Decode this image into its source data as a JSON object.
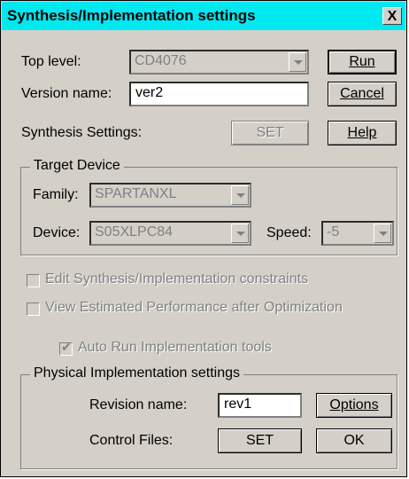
{
  "window": {
    "title": "Synthesis/Implementation settings",
    "close_label": "X"
  },
  "top_level": {
    "label": "Top level:",
    "value": "CD4076"
  },
  "version_name": {
    "label": "Version name:",
    "value": "ver2"
  },
  "synthesis_settings": {
    "label": "Synthesis Settings:",
    "button": "SET"
  },
  "buttons": {
    "run": "Run",
    "cancel": "Cancel",
    "help": "Help"
  },
  "target_device": {
    "title": "Target Device",
    "family_label": "Family:",
    "family_value": "SPARTANXL",
    "device_label": "Device:",
    "device_value": "S05XLPC84",
    "speed_label": "Speed:",
    "speed_value": "-5"
  },
  "checkboxes": {
    "edit_constraints": "Edit Synthesis/Implementation constraints",
    "view_performance": "View Estimated Performance after Optimization",
    "auto_run": "Auto Run Implementation tools"
  },
  "physical": {
    "title": "Physical Implementation settings",
    "revision_label": "Revision name:",
    "revision_value": "rev1",
    "options_button": "Options",
    "control_files_label": "Control Files:",
    "set_button": "SET",
    "ok_button": "OK"
  }
}
